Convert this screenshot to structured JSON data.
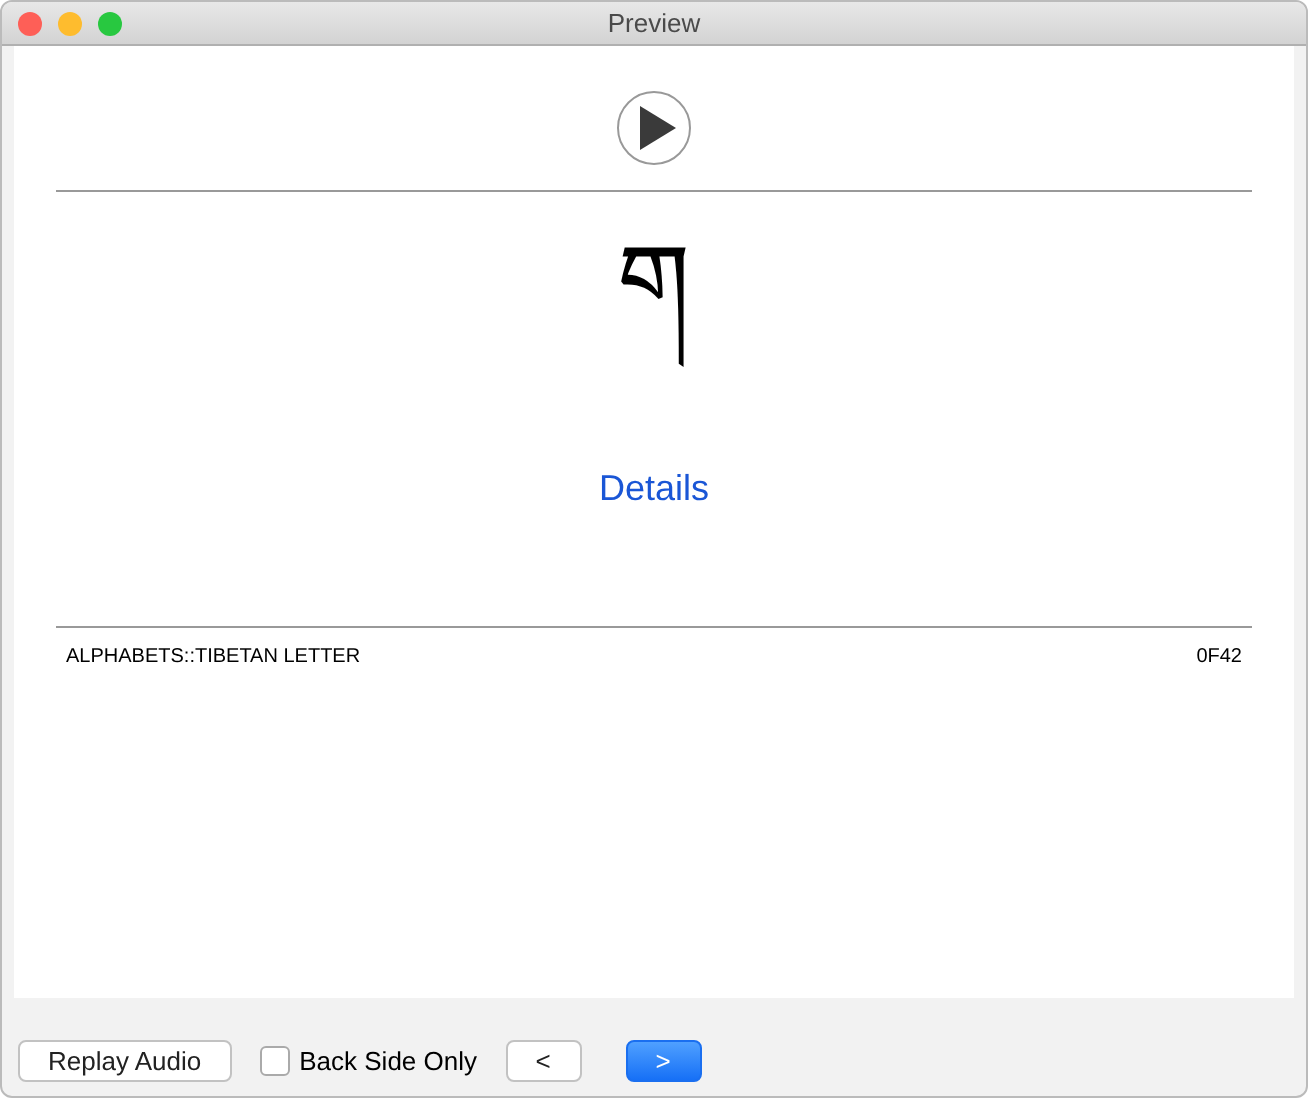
{
  "window": {
    "title": "Preview"
  },
  "card": {
    "glyph": "ག",
    "link": "Details",
    "footer_left": "ALPHABETS::TIBETAN LETTER",
    "footer_right": "0F42"
  },
  "toolbar": {
    "replay": "Replay Audio",
    "back_side_only": {
      "label": "Back Side Only",
      "checked": false
    },
    "prev": "<",
    "next": ">"
  }
}
